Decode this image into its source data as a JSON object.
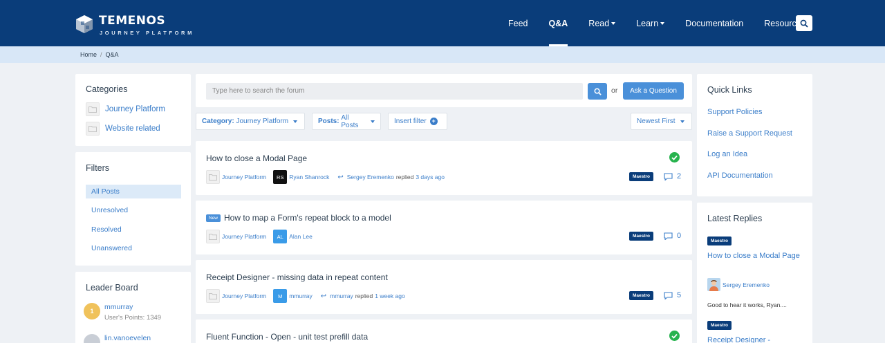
{
  "brand": {
    "name": "TEMENOS",
    "sub": "JOURNEY PLATFORM"
  },
  "nav": {
    "items": [
      {
        "label": "Feed",
        "dropdown": false,
        "active": false
      },
      {
        "label": "Q&A",
        "dropdown": false,
        "active": true
      },
      {
        "label": "Read",
        "dropdown": true,
        "active": false
      },
      {
        "label": "Learn",
        "dropdown": true,
        "active": false
      },
      {
        "label": "Documentation",
        "dropdown": false,
        "active": false
      },
      {
        "label": "Resources",
        "dropdown": true,
        "active": false
      }
    ],
    "search_icon": "search-icon"
  },
  "breadcrumb": {
    "home": "Home",
    "sep": "/",
    "current": "Q&A"
  },
  "categories": {
    "title": "Categories",
    "items": [
      {
        "label": "Journey Platform"
      },
      {
        "label": "Website related"
      }
    ]
  },
  "filters": {
    "title": "Filters",
    "items": [
      {
        "label": "All Posts",
        "active": true
      },
      {
        "label": "Unresolved"
      },
      {
        "label": "Resolved"
      },
      {
        "label": "Unanswered"
      }
    ]
  },
  "leaderboard": {
    "title": "Leader Board",
    "items": [
      {
        "rank": "1",
        "name": "mmurray",
        "points": "User's Points: 1349",
        "color": "#f0c25b"
      },
      {
        "rank": "",
        "name": "lin.vanoevelen",
        "points": "",
        "color": "#c9ced6"
      }
    ]
  },
  "search": {
    "placeholder": "Type here to search the forum",
    "or": "or",
    "ask_label": "Ask a Question"
  },
  "toolbar": {
    "category": {
      "key": "Category:",
      "value": "Journey Platform"
    },
    "posts": {
      "key": "Posts:",
      "value": "All Posts"
    },
    "insert_filter": "Insert filter",
    "sort": "Newest First"
  },
  "posts": [
    {
      "title": "How to close a Modal Page",
      "new": false,
      "resolved": true,
      "category": "Journey Platform",
      "author_initials": "RS",
      "author": "Ryan Shanrock",
      "author_color": "#111111",
      "replier": "Sergey Eremenko",
      "reply_text": "replied",
      "when": "3 days ago",
      "tag": "Maestro",
      "count": "2"
    },
    {
      "title": "How to map a Form's repeat block to a model",
      "new": true,
      "new_label": "New",
      "resolved": false,
      "category": "Journey Platform",
      "author_initials": "AL",
      "author": "Alan Lee",
      "author_color": "#3a9be8",
      "replier": "",
      "reply_text": "",
      "when": "",
      "tag": "Maestro",
      "count": "0"
    },
    {
      "title": "Receipt Designer - missing data in repeat content",
      "new": false,
      "resolved": false,
      "category": "Journey Platform",
      "author_initials": "M",
      "author": "mmurray",
      "author_color": "#3a9be8",
      "replier": "mmurray",
      "reply_text": "replied",
      "when": "1 week ago",
      "tag": "Maestro",
      "count": "5"
    },
    {
      "title": "Fluent Function - Open - unit test prefill data",
      "new": false,
      "resolved": true
    }
  ],
  "quick_links": {
    "title": "Quick Links",
    "items": [
      {
        "label": "Support Policies"
      },
      {
        "label": "Raise a Support Request"
      },
      {
        "label": "Log an Idea"
      },
      {
        "label": "API Documentation"
      }
    ]
  },
  "latest_replies": {
    "title": "Latest Replies",
    "items": [
      {
        "tag": "Maestro",
        "title": "How to close a Modal Page",
        "user": "Sergey Eremenko",
        "text": "Good to hear it works, Ryan...."
      },
      {
        "tag": "Maestro",
        "title": "Receipt Designer -"
      }
    ]
  },
  "colors": {
    "header": "#0a3d7a",
    "accent": "#4a90d9",
    "link": "#3a7dc9",
    "success": "#27b34e"
  }
}
